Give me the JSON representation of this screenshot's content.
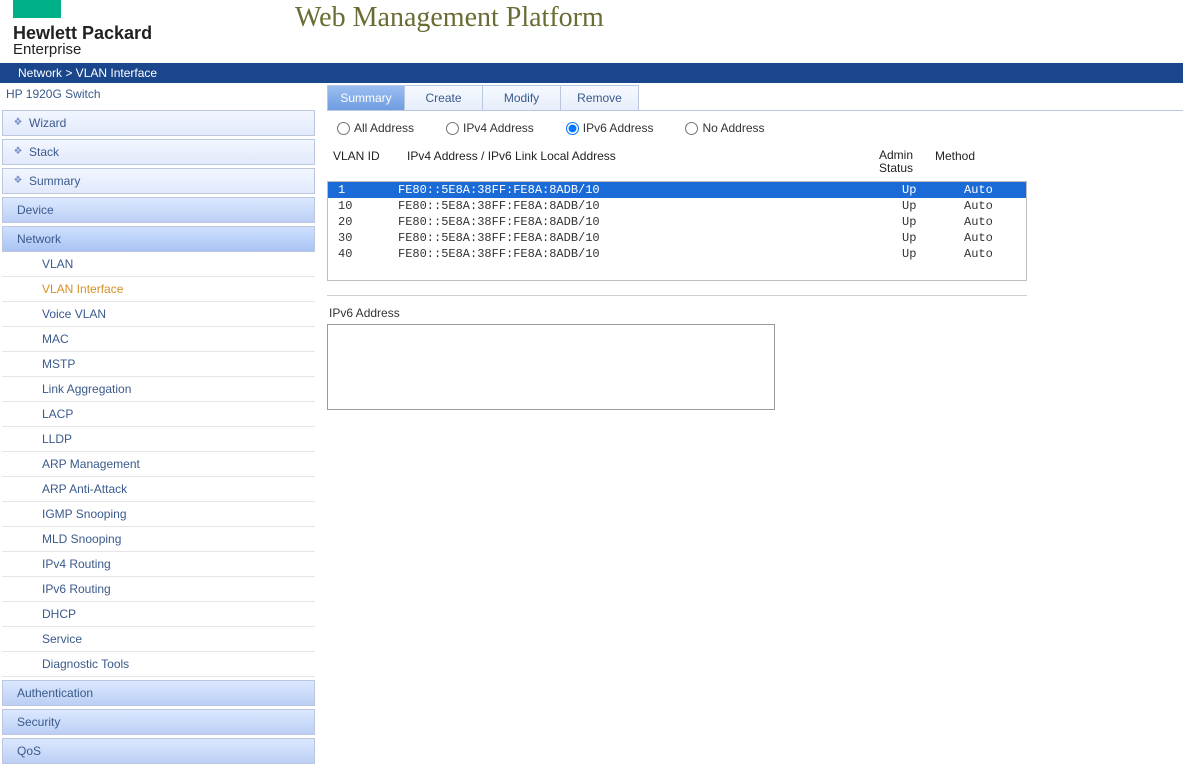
{
  "header": {
    "logo_line1": "Hewlett Packard",
    "logo_line2": "Enterprise",
    "title": "Web Management Platform"
  },
  "breadcrumb": {
    "text": "Network > VLAN Interface"
  },
  "sidebar": {
    "device": "HP 1920G Switch",
    "top": [
      {
        "label": "Wizard"
      },
      {
        "label": "Stack"
      },
      {
        "label": "Summary"
      }
    ],
    "cats": [
      {
        "label": "Device",
        "open": false
      },
      {
        "label": "Network",
        "open": true,
        "subs": [
          {
            "label": "VLAN"
          },
          {
            "label": "VLAN Interface",
            "active": true
          },
          {
            "label": "Voice VLAN"
          },
          {
            "label": "MAC"
          },
          {
            "label": "MSTP"
          },
          {
            "label": "Link Aggregation"
          },
          {
            "label": "LACP"
          },
          {
            "label": "LLDP"
          },
          {
            "label": "ARP Management"
          },
          {
            "label": "ARP Anti-Attack"
          },
          {
            "label": "IGMP Snooping"
          },
          {
            "label": "MLD Snooping"
          },
          {
            "label": "IPv4 Routing"
          },
          {
            "label": "IPv6 Routing"
          },
          {
            "label": "DHCP"
          },
          {
            "label": "Service"
          },
          {
            "label": "Diagnostic Tools"
          }
        ]
      },
      {
        "label": "Authentication",
        "open": false
      },
      {
        "label": "Security",
        "open": false
      },
      {
        "label": "QoS",
        "open": false
      }
    ]
  },
  "tabs": [
    {
      "label": "Summary",
      "active": true
    },
    {
      "label": "Create"
    },
    {
      "label": "Modify"
    },
    {
      "label": "Remove"
    }
  ],
  "filters": {
    "options": [
      {
        "label": "All Address",
        "value": "all"
      },
      {
        "label": "IPv4 Address",
        "value": "ipv4"
      },
      {
        "label": "IPv6 Address",
        "value": "ipv6"
      },
      {
        "label": "No Address",
        "value": "none"
      }
    ],
    "selected": "ipv6"
  },
  "table": {
    "headers": {
      "vlan": "VLAN ID",
      "addr": "IPv4 Address / IPv6 Link Local Address",
      "status1": "Admin",
      "status2": "Status",
      "method": "Method"
    },
    "rows": [
      {
        "vlan": "1",
        "addr": "FE80::5E8A:38FF:FE8A:8ADB/10",
        "status": "Up",
        "method": "Auto",
        "selected": true
      },
      {
        "vlan": "10",
        "addr": "FE80::5E8A:38FF:FE8A:8ADB/10",
        "status": "Up",
        "method": "Auto"
      },
      {
        "vlan": "20",
        "addr": "FE80::5E8A:38FF:FE8A:8ADB/10",
        "status": "Up",
        "method": "Auto"
      },
      {
        "vlan": "30",
        "addr": "FE80::5E8A:38FF:FE8A:8ADB/10",
        "status": "Up",
        "method": "Auto"
      },
      {
        "vlan": "40",
        "addr": "FE80::5E8A:38FF:FE8A:8ADB/10",
        "status": "Up",
        "method": "Auto"
      }
    ]
  },
  "ipv6": {
    "label": "IPv6 Address",
    "value": ""
  }
}
